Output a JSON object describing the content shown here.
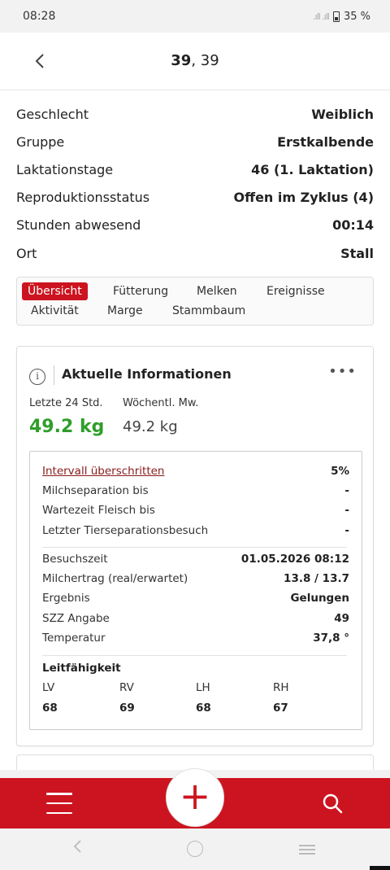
{
  "status_bar": {
    "time": "08:28",
    "signal": ".ıll .ıll",
    "battery": "35 %"
  },
  "header": {
    "title_bold": "39",
    "title_rest": ", 39"
  },
  "attributes": [
    {
      "label": "Geschlecht",
      "value": "Weiblich"
    },
    {
      "label": "Gruppe",
      "value": "Erstkalbende"
    },
    {
      "label": "Laktationstage",
      "value": "46 (1. Laktation)"
    },
    {
      "label": "Reproduktionsstatus",
      "value": "Offen im Zyklus (4)"
    },
    {
      "label": "Stunden abwesend",
      "value": "00:14"
    },
    {
      "label": "Ort",
      "value": "Stall"
    }
  ],
  "tabs": [
    "Übersicht",
    "Fütterung",
    "Melken",
    "Ereignisse",
    "Aktivität",
    "Marge",
    "Stammbaum"
  ],
  "card": {
    "title": "Aktuelle Informationen",
    "more": "•••",
    "label_24h": "Letzte 24 Std.",
    "label_weekly": "Wöchentl. Mw.",
    "value_24h": "49.2 kg",
    "value_weekly": "49.2 kg",
    "rows_top": [
      {
        "label": "Intervall überschritten",
        "value": "5%"
      },
      {
        "label": "Milchseparation bis",
        "value": "-"
      },
      {
        "label": "Wartezeit Fleisch bis",
        "value": "-"
      },
      {
        "label": "Letzter Tierseparationsbesuch",
        "value": "-"
      }
    ],
    "rows_visit": [
      {
        "label": "Besuchszeit",
        "value": "01.05.2026 08:12"
      },
      {
        "label": "Milchertrag (real/erwartet)",
        "value": "13.8 / 13.7"
      },
      {
        "label": "Ergebnis",
        "value": "Gelungen"
      },
      {
        "label": "SZZ Angabe",
        "value": "49"
      },
      {
        "label": "Temperatur",
        "value": "37,8 °"
      }
    ],
    "conductivity": {
      "title": "Leitfähigkeit",
      "headers": [
        "LV",
        "RV",
        "LH",
        "RH"
      ],
      "values": [
        "68",
        "69",
        "68",
        "67"
      ]
    }
  },
  "colors": {
    "accent": "#cc1420",
    "green": "#2e9e2a"
  },
  "bottom_bar": {
    "menu_icon": "hamburger-icon",
    "add_icon": "plus-icon",
    "search_icon": "search-icon",
    "add_label": "+"
  }
}
